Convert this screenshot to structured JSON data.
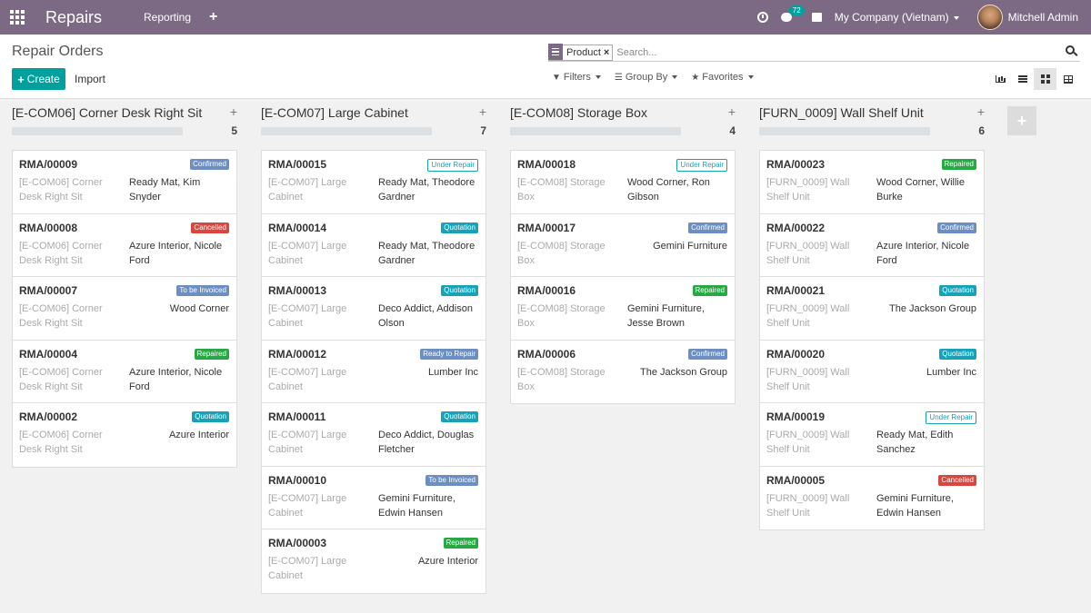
{
  "navbar": {
    "app_name": "Repairs",
    "menu_reporting": "Reporting",
    "menu_plus": "+",
    "chat_count": "72",
    "company": "My Company (Vietnam)",
    "user": "Mitchell Admin"
  },
  "control": {
    "breadcrumb": "Repair Orders",
    "create_label": "Create",
    "import_label": "Import",
    "facet_value": "Product",
    "facet_close": "×",
    "search_placeholder": "Search...",
    "filters_label": "Filters",
    "groupby_label": "Group By",
    "favorites_label": "Favorites"
  },
  "status_colors": {
    "Confirmed": "#6c8ec1",
    "Cancelled": "#d9463e",
    "To be Invoiced": "#6c8ec1",
    "Repaired": "#28a745",
    "Quotation": "#17a2b8",
    "Under Repair": "#ffffff",
    "Ready to Repair": "#6c8ec1"
  },
  "columns": [
    {
      "title": "[E-COM06] Corner Desk Right Sit",
      "count": "5",
      "cards": [
        {
          "name": "RMA/00009",
          "status": "Confirmed",
          "product": "[E-COM06] Corner Desk Right Sit",
          "partner": "Ready Mat, Kim Snyder",
          "align": "left"
        },
        {
          "name": "RMA/00008",
          "status": "Cancelled",
          "product": "[E-COM06] Corner Desk Right Sit",
          "partner": "Azure Interior, Nicole Ford",
          "align": "left"
        },
        {
          "name": "RMA/00007",
          "status": "To be Invoiced",
          "product": "[E-COM06] Corner Desk Right Sit",
          "partner": "Wood Corner",
          "align": "right"
        },
        {
          "name": "RMA/00004",
          "status": "Repaired",
          "product": "[E-COM06] Corner Desk Right Sit",
          "partner": "Azure Interior, Nicole Ford",
          "align": "left"
        },
        {
          "name": "RMA/00002",
          "status": "Quotation",
          "product": "[E-COM06] Corner Desk Right Sit",
          "partner": "Azure Interior",
          "align": "right"
        }
      ]
    },
    {
      "title": "[E-COM07] Large Cabinet",
      "count": "7",
      "cards": [
        {
          "name": "RMA/00015",
          "status": "Under Repair",
          "product": "[E-COM07] Large Cabinet",
          "partner": "Ready Mat, Theodore Gardner",
          "align": "left"
        },
        {
          "name": "RMA/00014",
          "status": "Quotation",
          "product": "[E-COM07] Large Cabinet",
          "partner": "Ready Mat, Theodore Gardner",
          "align": "left"
        },
        {
          "name": "RMA/00013",
          "status": "Quotation",
          "product": "[E-COM07] Large Cabinet",
          "partner": "Deco Addict, Addison Olson",
          "align": "left"
        },
        {
          "name": "RMA/00012",
          "status": "Ready to Repair",
          "product": "[E-COM07] Large Cabinet",
          "partner": "Lumber Inc",
          "align": "right"
        },
        {
          "name": "RMA/00011",
          "status": "Quotation",
          "product": "[E-COM07] Large Cabinet",
          "partner": "Deco Addict, Douglas Fletcher",
          "align": "left"
        },
        {
          "name": "RMA/00010",
          "status": "To be Invoiced",
          "product": "[E-COM07] Large Cabinet",
          "partner": "Gemini Furniture, Edwin Hansen",
          "align": "left"
        },
        {
          "name": "RMA/00003",
          "status": "Repaired",
          "product": "[E-COM07] Large Cabinet",
          "partner": "Azure Interior",
          "align": "right"
        }
      ]
    },
    {
      "title": "[E-COM08] Storage Box",
      "count": "4",
      "cards": [
        {
          "name": "RMA/00018",
          "status": "Under Repair",
          "product": "[E-COM08] Storage Box",
          "partner": "Wood Corner, Ron Gibson",
          "align": "left"
        },
        {
          "name": "RMA/00017",
          "status": "Confirmed",
          "product": "[E-COM08] Storage Box",
          "partner": "Gemini Furniture",
          "align": "right"
        },
        {
          "name": "RMA/00016",
          "status": "Repaired",
          "product": "[E-COM08] Storage Box",
          "partner": "Gemini Furniture, Jesse Brown",
          "align": "left"
        },
        {
          "name": "RMA/00006",
          "status": "Confirmed",
          "product": "[E-COM08] Storage Box",
          "partner": "The Jackson Group",
          "align": "right"
        }
      ]
    },
    {
      "title": "[FURN_0009] Wall Shelf Unit",
      "count": "6",
      "cards": [
        {
          "name": "RMA/00023",
          "status": "Repaired",
          "product": "[FURN_0009] Wall Shelf Unit",
          "partner": "Wood Corner, Willie Burke",
          "align": "left"
        },
        {
          "name": "RMA/00022",
          "status": "Confirmed",
          "product": "[FURN_0009] Wall Shelf Unit",
          "partner": "Azure Interior, Nicole Ford",
          "align": "left"
        },
        {
          "name": "RMA/00021",
          "status": "Quotation",
          "product": "[FURN_0009] Wall Shelf Unit",
          "partner": "The Jackson Group",
          "align": "right"
        },
        {
          "name": "RMA/00020",
          "status": "Quotation",
          "product": "[FURN_0009] Wall Shelf Unit",
          "partner": "Lumber Inc",
          "align": "right"
        },
        {
          "name": "RMA/00019",
          "status": "Under Repair",
          "product": "[FURN_0009] Wall Shelf Unit",
          "partner": "Ready Mat, Edith Sanchez",
          "align": "left"
        },
        {
          "name": "RMA/00005",
          "status": "Cancelled",
          "product": "[FURN_0009] Wall Shelf Unit",
          "partner": "Gemini Furniture, Edwin Hansen",
          "align": "left"
        }
      ]
    }
  ]
}
